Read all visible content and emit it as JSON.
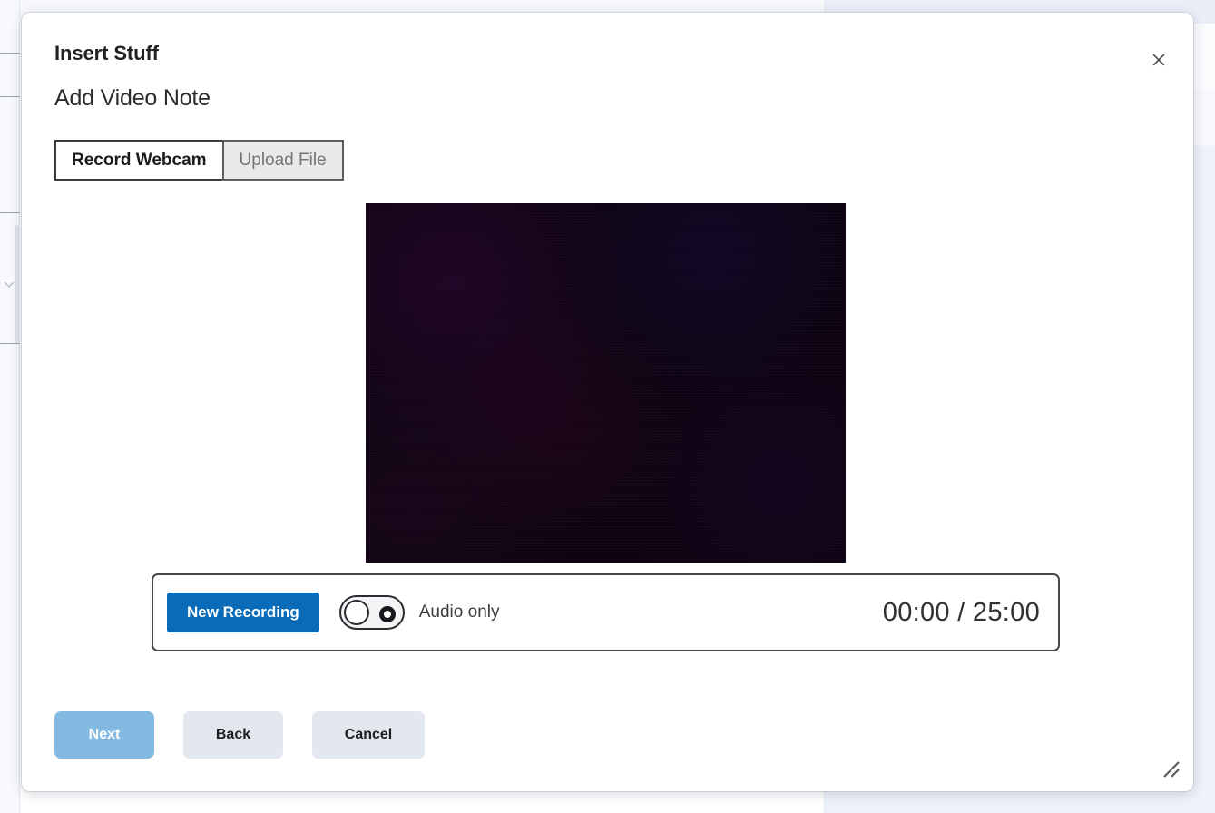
{
  "dialog": {
    "title": "Insert Stuff",
    "subtitle": "Add Video Note",
    "close_label": "Close",
    "tabs": [
      {
        "label": "Record Webcam",
        "active": true
      },
      {
        "label": "Upload File",
        "active": false
      }
    ],
    "controls": {
      "new_recording_label": "New Recording",
      "audio_only_label": "Audio only",
      "audio_only_enabled": false,
      "timer_elapsed": "00:00",
      "timer_total": "25:00",
      "timer_display": "00:00 / 25:00"
    },
    "footer": {
      "next_label": "Next",
      "next_disabled": true,
      "back_label": "Back",
      "cancel_label": "Cancel"
    },
    "colors": {
      "primary_blue": "#0a6cb8",
      "next_disabled_blue": "#83bae2",
      "secondary_grey": "#e3e8ef",
      "border_dark": "#44474b",
      "tab_inactive_bg": "#e9e9e9",
      "video_background": "#0c020f"
    }
  }
}
